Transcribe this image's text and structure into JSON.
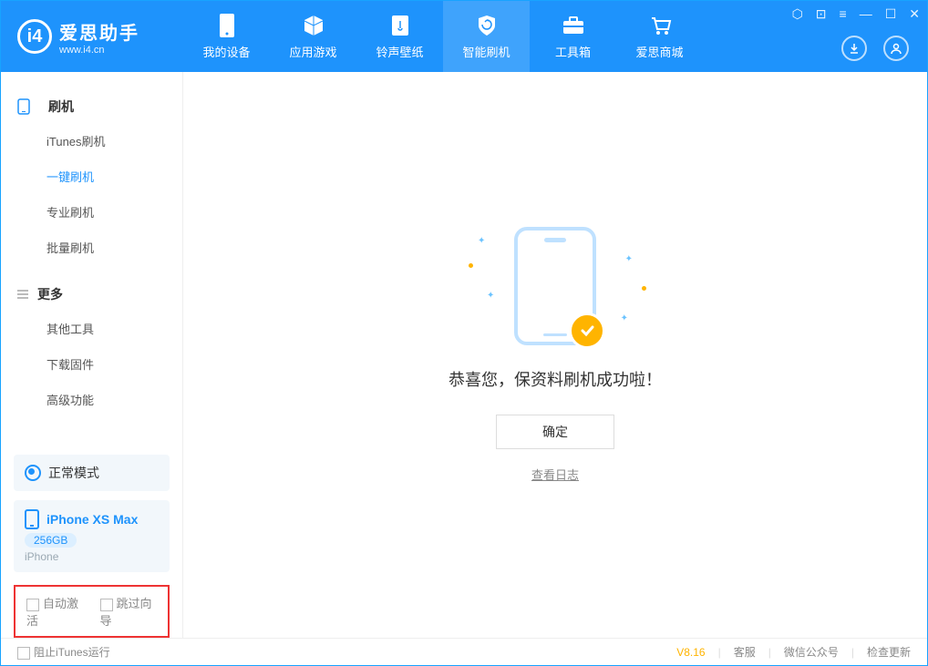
{
  "app": {
    "name": "爱思助手",
    "url": "www.i4.cn"
  },
  "nav": {
    "items": [
      {
        "label": "我的设备",
        "icon": "phone"
      },
      {
        "label": "应用游戏",
        "icon": "cube"
      },
      {
        "label": "铃声壁纸",
        "icon": "note"
      },
      {
        "label": "智能刷机",
        "icon": "shield",
        "active": true
      },
      {
        "label": "工具箱",
        "icon": "toolbox"
      },
      {
        "label": "爱思商城",
        "icon": "cart"
      }
    ]
  },
  "sidebar": {
    "group1": {
      "title": "刷机",
      "items": [
        "iTunes刷机",
        "一键刷机",
        "专业刷机",
        "批量刷机"
      ],
      "active_index": 1
    },
    "group2": {
      "title": "更多",
      "items": [
        "其他工具",
        "下载固件",
        "高级功能"
      ]
    }
  },
  "device": {
    "mode": "正常模式",
    "name": "iPhone XS Max",
    "storage": "256GB",
    "type": "iPhone"
  },
  "checkboxes": {
    "auto_activate": "自动激活",
    "skip_guide": "跳过向导"
  },
  "main": {
    "success": "恭喜您，保资料刷机成功啦！",
    "ok": "确定",
    "view_log": "查看日志"
  },
  "statusbar": {
    "stop_itunes": "阻止iTunes运行",
    "version": "V8.16",
    "links": [
      "客服",
      "微信公众号",
      "检查更新"
    ]
  }
}
